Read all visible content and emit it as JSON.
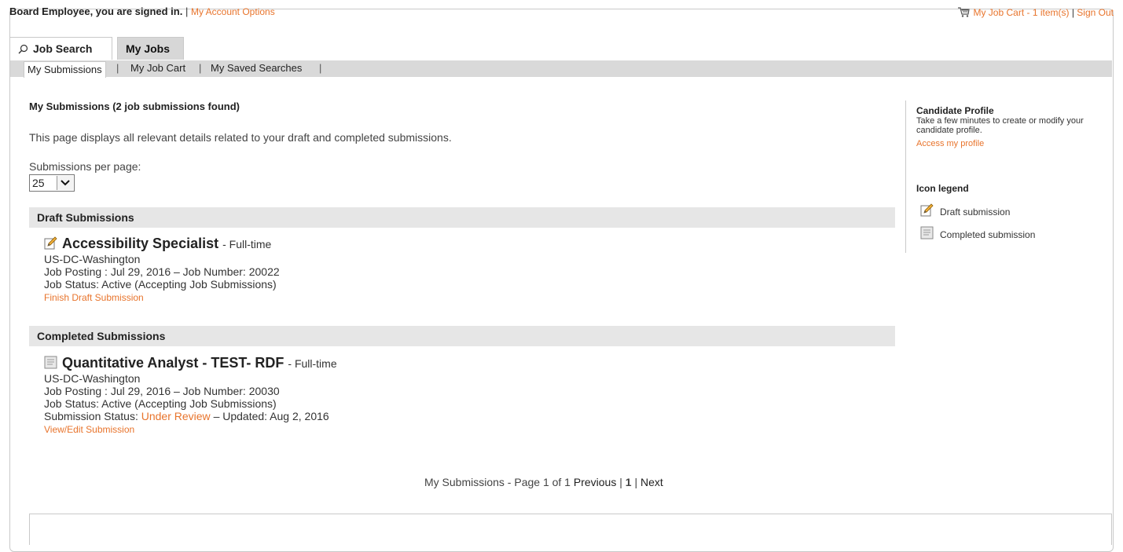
{
  "header": {
    "signed_in": "Board Employee, you are signed in.",
    "separator": "|",
    "account_options": "My Account Options",
    "cart": "My Job Cart - 1 item(s)",
    "sign_out": "Sign Out"
  },
  "tabs": [
    {
      "label": "Job Search"
    },
    {
      "label": "My Jobs"
    }
  ],
  "subnav": [
    {
      "label": "My Submissions"
    },
    {
      "label": "My Job Cart"
    },
    {
      "label": "My Saved Searches"
    }
  ],
  "subnav_separator": "|",
  "page": {
    "title": "My Submissions (2 job submissions found)",
    "description": "This page displays all relevant details related to your draft and completed submissions.",
    "per_page_label": "Submissions per page:",
    "per_page_value": "25"
  },
  "draft": {
    "header": "Draft Submissions",
    "job_title": "Accessibility Specialist",
    "job_type": "- Full-time",
    "location": "US-DC-Washington",
    "posting": "Job Posting : Jul 29, 2016 – Job Number: 20022",
    "status": "Job Status: Active (Accepting Job Submissions)",
    "action": "Finish Draft Submission"
  },
  "completed": {
    "header": "Completed Submissions",
    "job_title": "Quantitative Analyst - TEST- RDF",
    "job_type": "- Full-time",
    "location": "US-DC-Washington",
    "posting": "Job Posting : Jul 29, 2016 – Job Number: 20030",
    "status": "Job Status: Active (Accepting Job Submissions)",
    "submission_status_label": "Submission Status:",
    "submission_status_value": "Under Review",
    "updated": "– Updated: Aug 2, 2016",
    "action": "View/Edit Submission"
  },
  "pager": {
    "label": "My Submissions - Page 1 of 1",
    "previous": "Previous",
    "sep": "|",
    "current": "1",
    "next": "Next"
  },
  "sidebar": {
    "profile_title": "Candidate Profile",
    "profile_text": "Take a few minutes to create or modify your candidate profile.",
    "profile_link": "Access my profile",
    "legend_title": "Icon legend",
    "legend_draft": "Draft submission",
    "legend_completed": "Completed submission"
  },
  "colors": {
    "link": "#e8742c",
    "section_bg": "#e6e6e6",
    "subnav_bg": "#d9d9d9"
  },
  "icons": [
    "search-icon",
    "cart-icon",
    "pencil-icon",
    "document-icon",
    "chevron-down-icon"
  ]
}
